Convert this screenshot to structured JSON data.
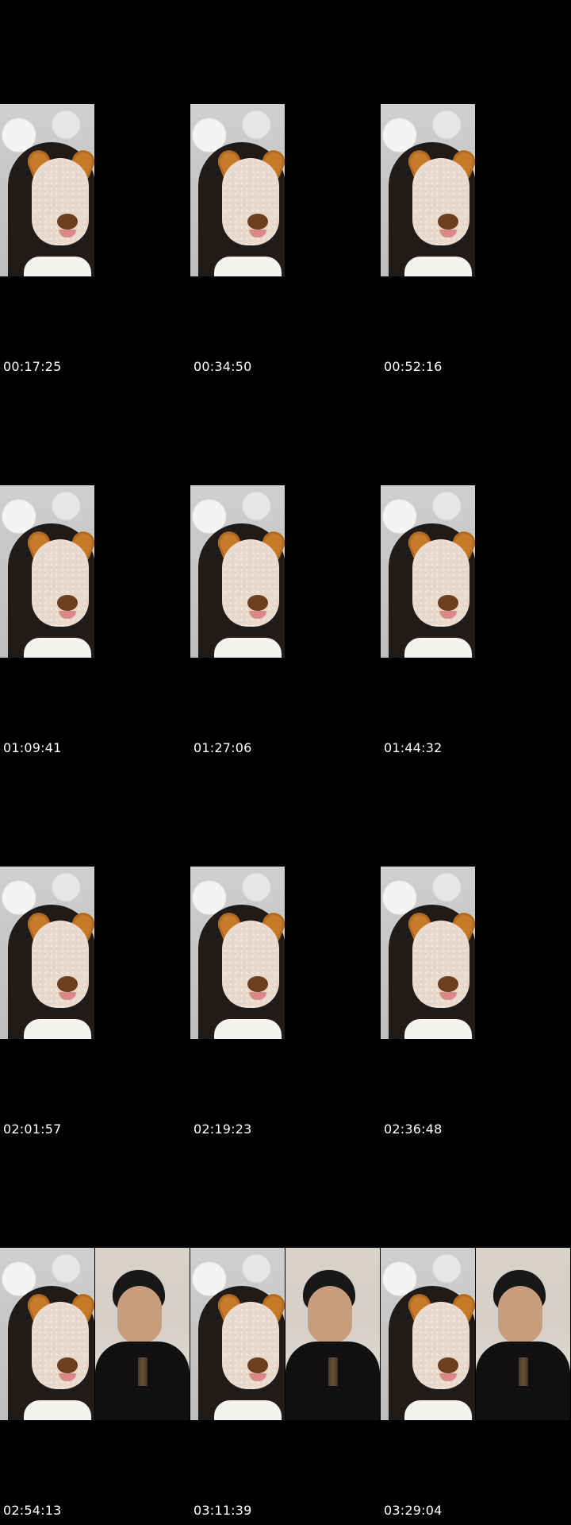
{
  "timestamps": [
    "00:17:25",
    "00:34:50",
    "00:52:16",
    "01:09:41",
    "01:27:06",
    "01:44:32",
    "02:01:57",
    "02:19:23",
    "02:36:48",
    "02:54:13",
    "03:11:39",
    "03:29:04"
  ],
  "colors": {
    "background": "#000000",
    "text": "#ffffff"
  }
}
